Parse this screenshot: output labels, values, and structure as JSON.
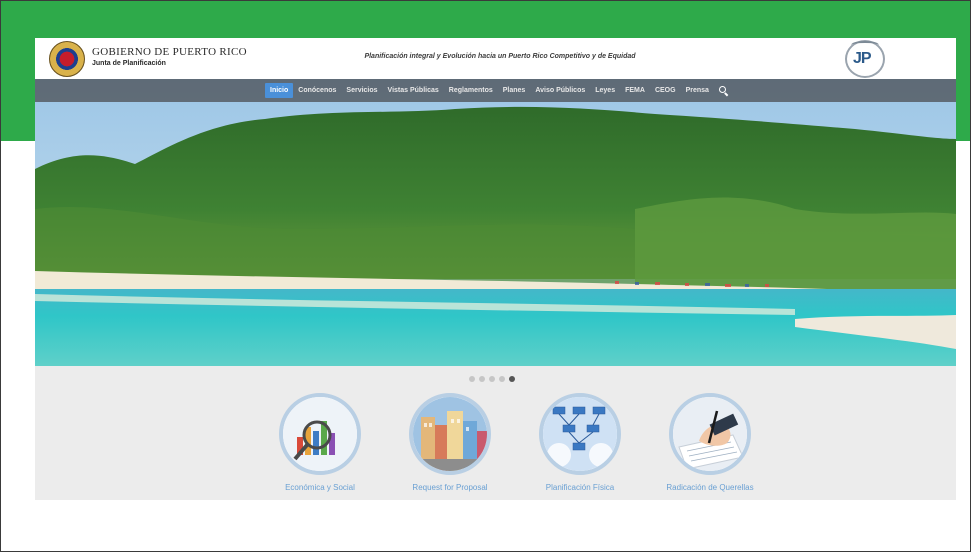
{
  "header": {
    "gov_title": "GOBIERNO DE PUERTO RICO",
    "gov_subtitle": "Junta de Planificación",
    "tagline": "Planificación integral y Evolución hacia un Puerto Rico Competitivo y de Equidad",
    "logo_text": "JP"
  },
  "nav": {
    "items": [
      {
        "label": "Inicio",
        "active": true
      },
      {
        "label": "Conócenos",
        "active": false
      },
      {
        "label": "Servicios",
        "active": false
      },
      {
        "label": "Vistas Públicas",
        "active": false
      },
      {
        "label": "Reglamentos",
        "active": false
      },
      {
        "label": "Planes",
        "active": false
      },
      {
        "label": "Aviso Públicos",
        "active": false
      },
      {
        "label": "Leyes",
        "active": false
      },
      {
        "label": "FEMA",
        "active": false
      },
      {
        "label": "CEOG",
        "active": false
      },
      {
        "label": "Prensa",
        "active": false
      }
    ],
    "search_icon": "search-icon"
  },
  "carousel": {
    "slide_count": 5,
    "active_index": 4
  },
  "cards": [
    {
      "label": "Económica y Social",
      "icon": "economics-chart-image"
    },
    {
      "label": "Request for Proposal",
      "icon": "city-street-image"
    },
    {
      "label": "Planificación Física",
      "icon": "flowchart-image"
    },
    {
      "label": "Radicación de Querellas",
      "icon": "writing-hand-image"
    }
  ],
  "colors": {
    "brand_green": "#2eaa4a",
    "nav_active": "#4a90d9",
    "card_label": "#6aa0d3"
  }
}
